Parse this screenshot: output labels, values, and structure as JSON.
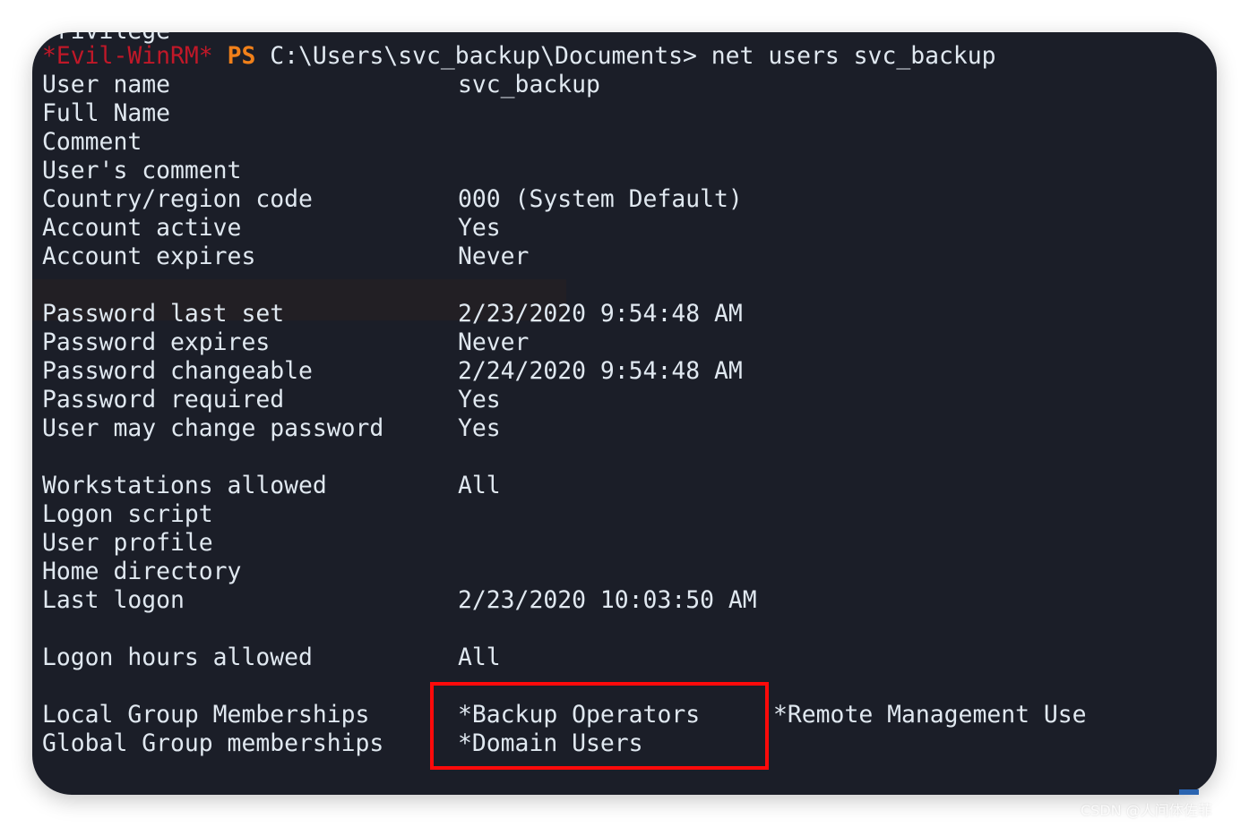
{
  "terminal": {
    "partial_top_line": "Privilege",
    "prompt": {
      "shell_tag": "*Evil-WinRM*",
      "ps_label": "PS",
      "path": "C:\\Users\\svc_backup\\Documents>",
      "command": "net users svc_backup"
    },
    "rows": [
      {
        "label": "User name",
        "value": "svc_backup"
      },
      {
        "label": "Full Name",
        "value": ""
      },
      {
        "label": "Comment",
        "value": ""
      },
      {
        "label": "User's comment",
        "value": ""
      },
      {
        "label": "Country/region code",
        "value": "000 (System Default)"
      },
      {
        "label": "Account active",
        "value": "Yes"
      },
      {
        "label": "Account expires",
        "value": "Never"
      },
      null,
      {
        "label": "Password last set",
        "value": "2/23/2020 9:54:48 AM"
      },
      {
        "label": "Password expires",
        "value": "Never"
      },
      {
        "label": "Password changeable",
        "value": "2/24/2020 9:54:48 AM"
      },
      {
        "label": "Password required",
        "value": "Yes"
      },
      {
        "label": "User may change password",
        "value": "Yes"
      },
      null,
      {
        "label": "Workstations allowed",
        "value": "All"
      },
      {
        "label": "Logon script",
        "value": ""
      },
      {
        "label": "User profile",
        "value": ""
      },
      {
        "label": "Home directory",
        "value": ""
      },
      {
        "label": "Last logon",
        "value": "2/23/2020 10:03:50 AM"
      },
      null,
      {
        "label": "Logon hours allowed",
        "value": "All"
      },
      null,
      {
        "label": "Local Group Memberships",
        "value": "*Backup Operators",
        "extra": "*Remote Management Use"
      },
      {
        "label": "Global Group memberships",
        "value": "*Domain Users"
      }
    ]
  },
  "highlight_color": "#ff0a0a",
  "watermark": "CSDN @人间体佐菲"
}
